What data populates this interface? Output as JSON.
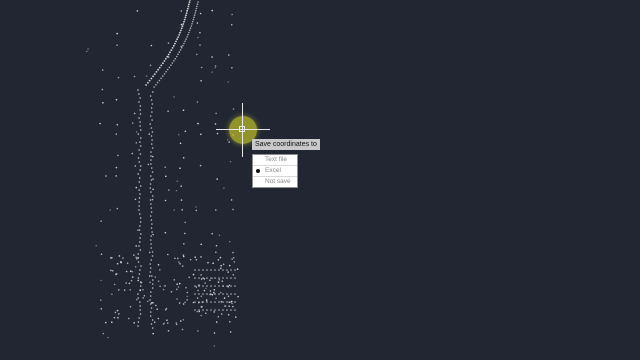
{
  "canvas": {
    "background": "#212632",
    "point_color": "#e8e8e8",
    "cursor_halo_color": "#bebe28"
  },
  "prompt": {
    "label": "Save coordinates to"
  },
  "options": [
    {
      "label": "Text file",
      "selected": false
    },
    {
      "label": "Excel",
      "selected": true
    },
    {
      "label": "Not save",
      "selected": false
    }
  ]
}
